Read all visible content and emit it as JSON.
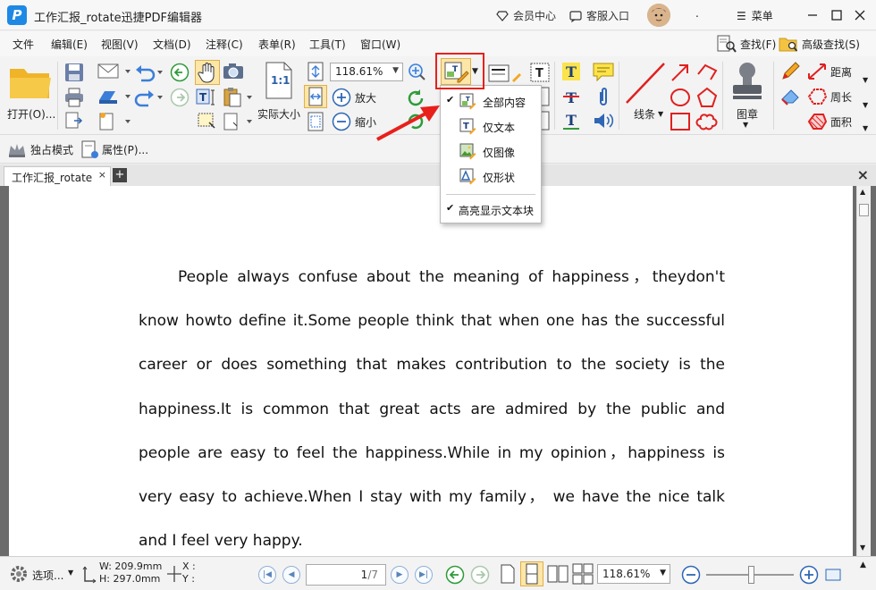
{
  "window": {
    "title": "工作汇报_rotate迅捷PDF编辑器",
    "logo_letter": "P",
    "member_center": "会员中心",
    "service": "客服入口",
    "dot": ".",
    "menu": "菜单"
  },
  "menubar": {
    "items": [
      "文件",
      "编辑(E)",
      "视图(V)",
      "文档(D)",
      "注释(C)",
      "表单(R)",
      "工具(T)",
      "窗口(W)"
    ],
    "find": "查找(F)",
    "advanced_find": "高级查找(S)"
  },
  "toolbar": {
    "open": "打开(O)...",
    "zoom_value": "118.61%",
    "actual_size": "实际大小",
    "actual_size_icon_text": "1:1",
    "zoom_in": "放大",
    "zoom_out": "缩小",
    "line": "线条",
    "stamp": "图章",
    "distance": "距离",
    "perimeter": "周长",
    "area": "面积"
  },
  "toolbar2": {
    "exclusive_mode": "独占模式",
    "properties": "属性(P)..."
  },
  "tabs": {
    "doc_tab": "工作汇报_rotate",
    "close": "×",
    "new": "+",
    "close_all": "×"
  },
  "dropdown": {
    "items": [
      {
        "label": "全部内容",
        "checked": true
      },
      {
        "label": "仅文本",
        "checked": false
      },
      {
        "label": "仅图像",
        "checked": false
      },
      {
        "label": "仅形状",
        "checked": false
      }
    ],
    "highlight_text_blocks": {
      "label": "高亮显示文本块",
      "checked": true
    }
  },
  "document": {
    "text": "People always confuse about the meaning of happiness，theydon't know howto define it.Some people think that when one has the successful career or does something that makes contribution to the society is the happiness.It is common that great acts are admired by the public and people are easy to feel the happiness.While in my opinion，happiness is very easy to achieve.When I stay with my family， we have the nice talk and I feel very happy."
  },
  "statusbar": {
    "options": "选项...",
    "width": "W: 209.9mm",
    "height": "H: 297.0mm",
    "x": "X :",
    "y": "Y :",
    "page_current": "1",
    "page_total": "/7",
    "zoom_value": "118.61%"
  },
  "colors": {
    "accent_blue": "#1e88e5",
    "highlight_red": "#e8201a",
    "line_red": "#e02020"
  }
}
